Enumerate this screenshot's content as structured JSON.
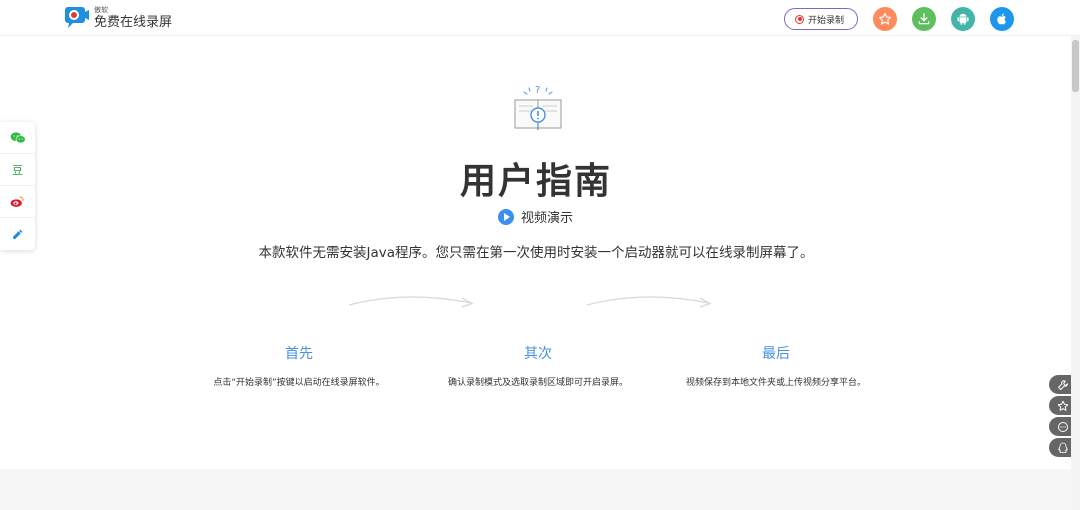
{
  "header": {
    "logo_sub": "傲软",
    "logo_title": "免费在线录屏",
    "start_record_label": "开始录制",
    "buttons": [
      {
        "icon": "star-icon",
        "color": "#ff8a5b"
      },
      {
        "icon": "download-icon",
        "color": "#5cc05c"
      },
      {
        "icon": "android-icon",
        "color": "#42b4a8"
      },
      {
        "icon": "apple-icon",
        "color": "#1f96ee"
      }
    ]
  },
  "share": {
    "items": [
      {
        "icon": "wechat-icon"
      },
      {
        "icon": "douban-icon",
        "label": "豆"
      },
      {
        "icon": "weibo-icon"
      },
      {
        "icon": "edit-icon"
      }
    ]
  },
  "main": {
    "title": "用户指南",
    "video_label": "视频演示",
    "description": "本款软件无需安装Java程序。您只需在第一次使用时安装一个启动器就可以在线录制屏幕了。",
    "steps": [
      {
        "title": "首先",
        "desc": "点击“开始录制”按键以启动在线录屏软件。"
      },
      {
        "title": "其次",
        "desc": "确认录制模式及选取录制区域即可开启录屏。"
      },
      {
        "title": "最后",
        "desc": "视频保存到本地文件夹或上传视频分享平台。"
      }
    ]
  },
  "tools": [
    {
      "icon": "wrench-icon"
    },
    {
      "icon": "star-outline-icon"
    },
    {
      "icon": "chat-icon"
    },
    {
      "icon": "qq-icon"
    }
  ],
  "colors": {
    "accent_blue": "#4a90e2",
    "record_border": "#7b68c8",
    "record_dot": "#e33333"
  }
}
